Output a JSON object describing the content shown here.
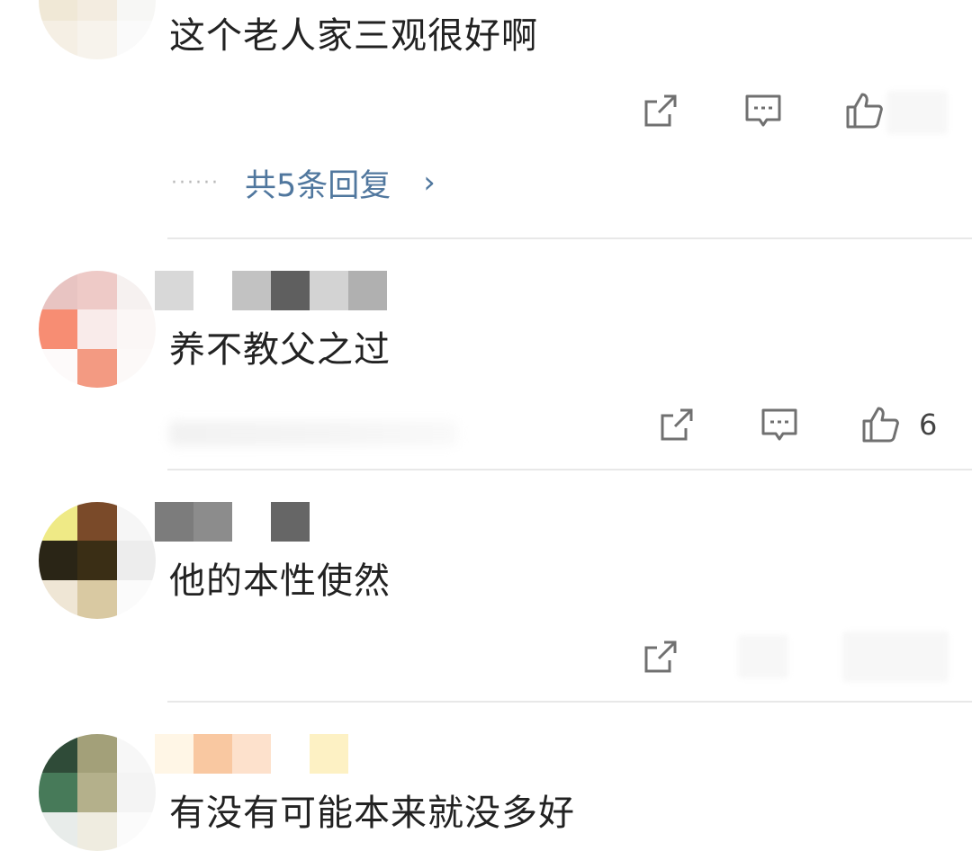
{
  "comments": [
    {
      "text": "这个老人家三观很好啊",
      "avatar_colors": [
        "#f0e6cf",
        "#eee7d9",
        "#f6f6f4",
        "#f0e8d6",
        "#f3ece0",
        "#f7f7f5",
        "#f5efe4",
        "#f7f3ec",
        "#fafafa"
      ],
      "like_count": "",
      "replies_label": "共5条回复",
      "replies_dots": "······"
    },
    {
      "text": "养不教父之过",
      "avatar_colors": [
        "#e8c4c2",
        "#eecac7",
        "#f6f1f0",
        "#f78d73",
        "#f9ebea",
        "#fbf7f6",
        "#fdfafa",
        "#f39a82",
        "#fcf9f8"
      ],
      "username_colors": [
        "#d8d8d8",
        "#ffffff",
        "#c2c2c2",
        "#5f5f5f",
        "#d3d3d3",
        "#b0b0b0"
      ],
      "like_count": "6"
    },
    {
      "text": "他的本性使然",
      "avatar_colors": [
        "#efea86",
        "#7a4a29",
        "#f6f6f6",
        "#2a2516",
        "#3a2e15",
        "#ededed",
        "#efe6d5",
        "#d9c9a2",
        "#fbfbfb"
      ],
      "username_colors": [
        "#7c7c7c",
        "#8c8c8c",
        "#ffffff",
        "#666666"
      ],
      "like_count": ""
    },
    {
      "text": "有没有可能本来就没多好",
      "avatar_colors": [
        "#2f4b38",
        "#a3a079",
        "#f7f7f7",
        "#477a59",
        "#b4b08b",
        "#f4f4f4",
        "#e8ecea",
        "#efece0",
        "#fbfbfb"
      ],
      "username_colors": [
        "#fff6e6",
        "#f9c8a1",
        "#fde1cc",
        "#ffffff",
        "#fdf1c4"
      ],
      "like_count": ""
    }
  ],
  "icons": {
    "share": "share-icon",
    "comment": "comment-icon",
    "like": "thumbs-up-icon",
    "chevron": "chevron-right-icon"
  },
  "colors": {
    "link": "#50779e",
    "text": "#222222",
    "icon": "#707070",
    "divider": "#e8e8e8"
  }
}
